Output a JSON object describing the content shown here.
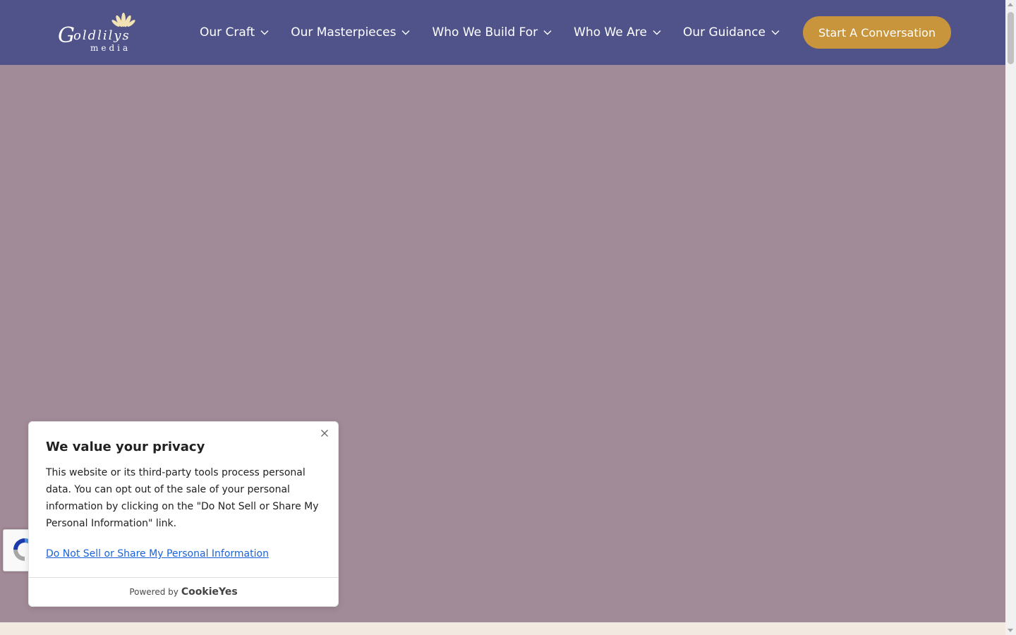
{
  "header": {
    "logo_alt": "Goldlilys media",
    "nav": [
      {
        "label": "Our Craft"
      },
      {
        "label": "Our Masterpieces"
      },
      {
        "label": "Who We Build For"
      },
      {
        "label": "Who We Are"
      },
      {
        "label": "Our Guidance"
      }
    ],
    "cta_label": "Start A Conversation"
  },
  "cookie": {
    "title": "We value your privacy",
    "body": "This website or its third-party tools process personal data. You can opt out of the sale of your personal information by clicking on the \"Do Not Sell or Share My Personal Information\" link.",
    "link": "Do Not Sell or Share My Personal Information",
    "powered_by": "Powered by",
    "brand": "CookieYes"
  },
  "icons": {
    "logo": "lotus-logo-icon",
    "nav_chevron": "chevron-down-icon",
    "close": "close-icon",
    "recaptcha": "recaptcha-icon"
  },
  "colors": {
    "header_bg": "#50538a",
    "hero_bg": "#a28b98",
    "cta_bg": "#c8953c",
    "link": "#1863dc",
    "footer_strip": "#f2e9e1"
  }
}
